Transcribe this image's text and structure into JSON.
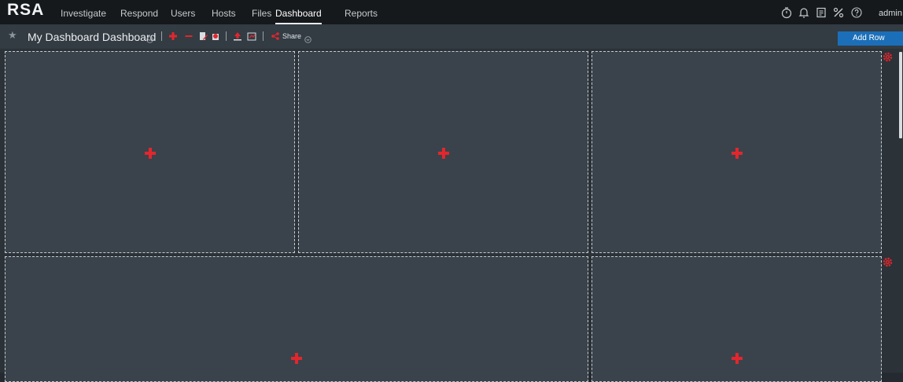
{
  "brand": {
    "logo_text": "RSA"
  },
  "nav": {
    "items": [
      {
        "label": "Investigate",
        "active": false
      },
      {
        "label": "Respond",
        "active": false
      },
      {
        "label": "Users",
        "active": false
      },
      {
        "label": "Hosts",
        "active": false
      },
      {
        "label": "Files",
        "active": false
      },
      {
        "label": "Dashboard",
        "active": true
      },
      {
        "label": "Reports",
        "active": false
      }
    ],
    "utility_icons": [
      "timer-icon",
      "bell-icon",
      "clipboard-icon",
      "tools-icon",
      "help-icon"
    ],
    "user_label": "admin"
  },
  "toolbar": {
    "title": "My Dashboard Dashboard",
    "actions": [
      "add-icon",
      "remove-icon",
      "edit-icon",
      "delete-icon",
      "import-icon",
      "export-icon",
      "share-icon"
    ],
    "share_label": "Share",
    "add_row_label": "Add Row"
  },
  "dashboard": {
    "rows": [
      {
        "columns": 3,
        "panel_action": "add-widget-icon",
        "row_action": "gear-icon"
      },
      {
        "columns": 2,
        "panel_action": "add-widget-icon",
        "row_action": "gear-icon"
      }
    ]
  },
  "colors": {
    "accent_red": "#e3262d",
    "button_blue": "#1b6fb8",
    "nav_background": "#15191c",
    "toolbar_background": "#333b43",
    "panel_background": "#3a434b"
  }
}
